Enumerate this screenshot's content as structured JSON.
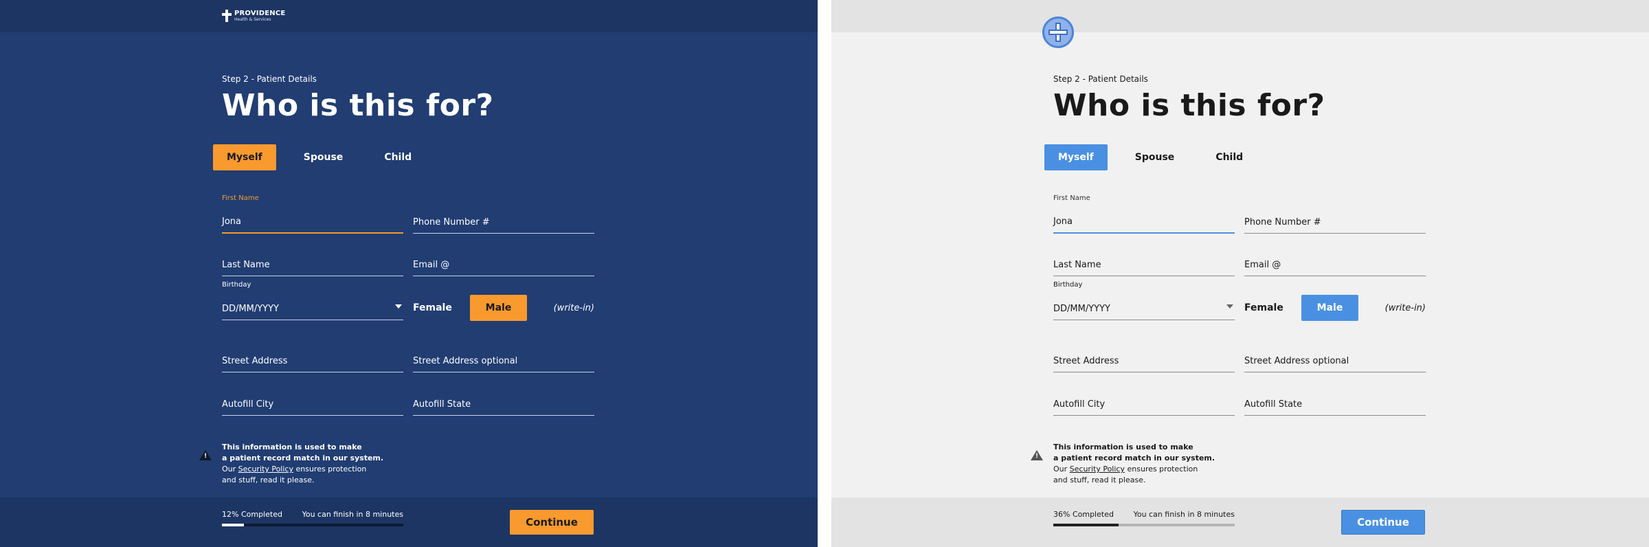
{
  "colors": {
    "dark_background": "#213d72",
    "dark_accent": "#f89a2e",
    "light_background": "#f1f1f1",
    "light_accent": "#4a90e2"
  },
  "dark": {
    "brand_name": "PROVIDENCE",
    "brand_sub": "Health & Services",
    "step": "Step 2 - Patient Details",
    "title": "Who is this for?",
    "tabs": [
      "Myself",
      "Spouse",
      "Child"
    ],
    "active_tab": "Myself",
    "first_name_label": "First Name",
    "first_name_value": "Jona",
    "phone_placeholder": "Phone Number #",
    "last_name_placeholder": "Last Name",
    "email_placeholder": "Email @",
    "birthday_label": "Birthday",
    "birthday_placeholder": "DD/MM/YYYY",
    "gender_female": "Female",
    "gender_male": "Male",
    "gender_writein": "(write-in)",
    "street_placeholder": "Street Address",
    "street2_placeholder": "Street Address optional",
    "city_placeholder": "Autofill City",
    "state_placeholder": "Autofill State",
    "info_line1": "This information is used to make",
    "info_line2": "a patient record match in our system.",
    "info_line3_pre": "Our",
    "info_link": "Security Policy",
    "info_line3_post": "ensures protection",
    "info_line4": "and stuff, read it please.",
    "progress_label": "12% Completed",
    "progress_fraction": 0.12,
    "eta": "You can finish in 8 minutes",
    "continue": "Continue"
  },
  "light": {
    "logo_icon": "cross-circle-icon",
    "step": "Step 2 - Patient Details",
    "title": "Who is this for?",
    "tabs": [
      "Myself",
      "Spouse",
      "Child"
    ],
    "active_tab": "Myself",
    "first_name_label": "First Name",
    "first_name_value": "Jona",
    "phone_placeholder": "Phone Number #",
    "last_name_placeholder": "Last Name",
    "email_placeholder": "Email @",
    "birthday_label": "Birthday",
    "birthday_placeholder": "DD/MM/YYYY",
    "gender_female": "Female",
    "gender_male": "Male",
    "gender_writein": "(write-in)",
    "street_placeholder": "Street Address",
    "street2_placeholder": "Street Address optional",
    "city_placeholder": "Autofill City",
    "state_placeholder": "Autofill State",
    "info_line1": "This information is used to make",
    "info_line2": "a patient record match in our system.",
    "info_line3_pre": "Our",
    "info_link": "Security Policy",
    "info_line3_post": "ensures protection",
    "info_line4": "and stuff, read it please.",
    "progress_label": "36% Completed",
    "progress_fraction": 0.36,
    "eta": "You can finish in 8 minutes",
    "continue": "Continue"
  }
}
